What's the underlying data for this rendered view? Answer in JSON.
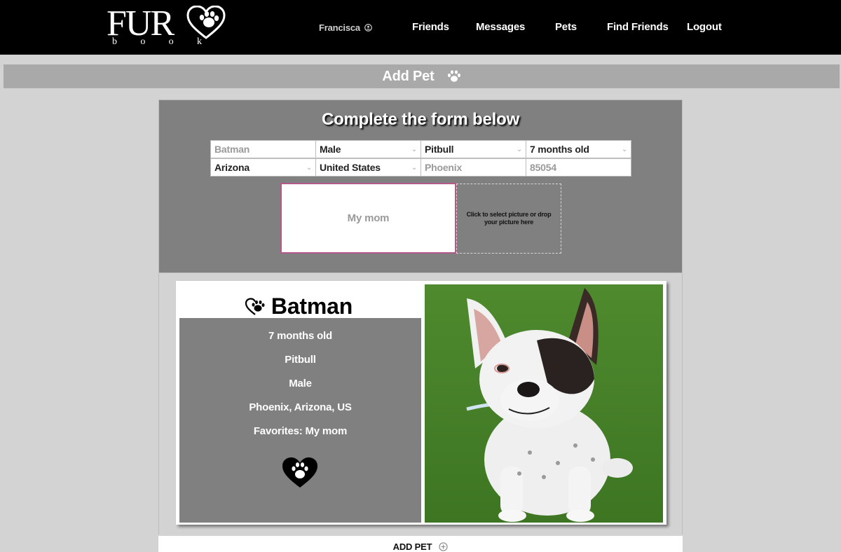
{
  "brand": {
    "logo_main": "FUR",
    "logo_sub": [
      "b",
      "o",
      "o",
      "k"
    ]
  },
  "nav": {
    "user_name": "Francisca",
    "links": [
      "Friends",
      "Messages",
      "Pets",
      "Find Friends",
      "Logout"
    ]
  },
  "page": {
    "title": "Add Pet"
  },
  "form": {
    "title": "Complete the form below",
    "name_placeholder": "Batman",
    "gender_value": "Male",
    "breed_value": "Pitbull",
    "age_value": "7 months old",
    "state_value": "Arizona",
    "country_value": "United States",
    "city_placeholder": "Phoenix",
    "zip_placeholder": "85054",
    "favorites_placeholder": "My mom",
    "dropzone_text": "Click to select picture or drop your picture here"
  },
  "preview": {
    "name": "Batman",
    "age": "7 months old",
    "breed": "Pitbull",
    "gender": "Male",
    "location": "Phoenix, Arizona, US",
    "favorites": "Favorites: My mom"
  },
  "add_pet": {
    "label": "ADD PET"
  },
  "colors": {
    "navbar": "#000000",
    "header_band": "#a9a9a9",
    "panel": "#808080",
    "focus_border": "#b35a8a"
  },
  "icons": [
    "user-circle-icon",
    "paw-icon",
    "heart-paw-icon",
    "plus-circle-icon",
    "chevron-down-icon"
  ]
}
